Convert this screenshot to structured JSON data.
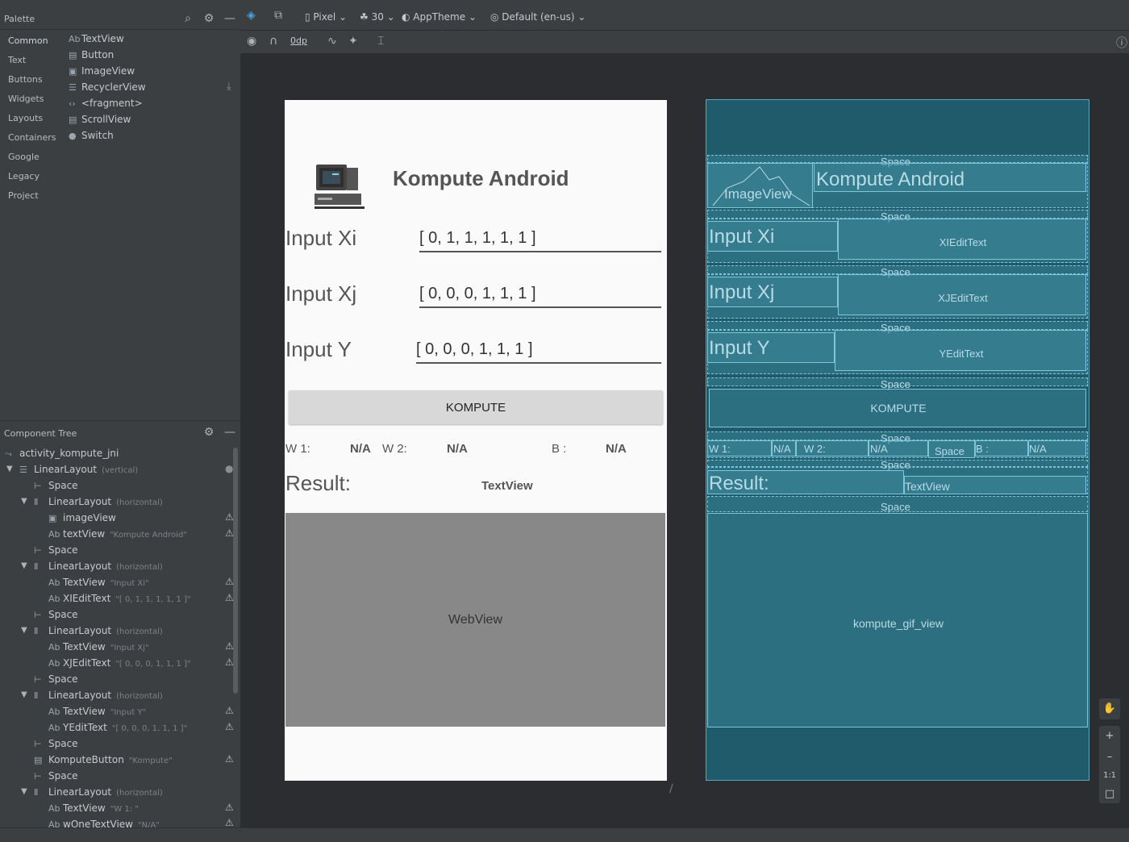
{
  "palette": {
    "title": "Palette",
    "categories": [
      "Common",
      "Text",
      "Buttons",
      "Widgets",
      "Layouts",
      "Containers",
      "Google",
      "Legacy",
      "Project"
    ],
    "items": [
      {
        "icon": "Ab",
        "label": "TextView"
      },
      {
        "icon": "▤",
        "label": "Button"
      },
      {
        "icon": "▣",
        "label": "ImageView"
      },
      {
        "icon": "☰",
        "label": "RecyclerView"
      },
      {
        "icon": "‹›",
        "label": "<fragment>"
      },
      {
        "icon": "▤",
        "label": "ScrollView"
      },
      {
        "icon": "●",
        "label": "Switch"
      }
    ]
  },
  "tree": {
    "title": "Component Tree",
    "root": "activity_kompute_jni",
    "rows": [
      {
        "icon": "☰",
        "label": "LinearLayout",
        "sub": "(vertical)",
        "expanded": true
      },
      {
        "icon": "⊢",
        "label": "Space",
        "sub": ""
      },
      {
        "icon": "Ⅱ",
        "label": "LinearLayout",
        "sub": "(horizontal)",
        "expanded": true
      },
      {
        "icon": "▣",
        "label": "imageView",
        "sub": ""
      },
      {
        "icon": "Ab",
        "label": "textView",
        "sub": "\"Kompute Android\""
      },
      {
        "icon": "⊢",
        "label": "Space",
        "sub": ""
      },
      {
        "icon": "Ⅱ",
        "label": "LinearLayout",
        "sub": "(horizontal)",
        "expanded": true
      },
      {
        "icon": "Ab",
        "label": "TextView",
        "sub": "\"Input Xi\""
      },
      {
        "icon": "Ab",
        "label": "XIEditText",
        "sub": "\"[ 0, 1, 1, 1, 1, 1 ]\""
      },
      {
        "icon": "⊢",
        "label": "Space",
        "sub": ""
      },
      {
        "icon": "Ⅱ",
        "label": "LinearLayout",
        "sub": "(horizontal)",
        "expanded": true
      },
      {
        "icon": "Ab",
        "label": "TextView",
        "sub": "\"Input Xj\""
      },
      {
        "icon": "Ab",
        "label": "XJEditText",
        "sub": "\"[ 0, 0, 0, 1, 1, 1 ]\""
      },
      {
        "icon": "⊢",
        "label": "Space",
        "sub": ""
      },
      {
        "icon": "Ⅱ",
        "label": "LinearLayout",
        "sub": "(horizontal)",
        "expanded": true
      },
      {
        "icon": "Ab",
        "label": "TextView",
        "sub": "\"Input Y\""
      },
      {
        "icon": "Ab",
        "label": "YEditText",
        "sub": "\"[ 0, 0, 0, 1, 1, 1 ]\""
      },
      {
        "icon": "⊢",
        "label": "Space",
        "sub": ""
      },
      {
        "icon": "▤",
        "label": "KomputeButton",
        "sub": "\"Kompute\""
      },
      {
        "icon": "⊢",
        "label": "Space",
        "sub": ""
      },
      {
        "icon": "Ⅱ",
        "label": "LinearLayout",
        "sub": "(horizontal)",
        "expanded": true
      },
      {
        "icon": "Ab",
        "label": "TextView",
        "sub": "\"W 1: \""
      },
      {
        "icon": "Ab",
        "label": "wOneTextView",
        "sub": "\"N/A\""
      }
    ]
  },
  "toolbar": {
    "device": "Pixel",
    "api": "30",
    "theme": "AppTheme",
    "locale": "Default (en-us)",
    "margin": "0dp"
  },
  "design": {
    "title": "Kompute Android",
    "input_xi_label": "Input Xi",
    "input_xi_value": "[ 0, 1, 1, 1, 1, 1 ]",
    "input_xj_label": "Input Xj",
    "input_xj_value": "[ 0, 0, 0, 1, 1, 1 ]",
    "input_y_label": "Input Y",
    "input_y_value": "[ 0, 0, 0, 1, 1, 1 ]",
    "button": "KOMPUTE",
    "w1_label": "W 1:",
    "w1_value": "N/A",
    "w2_label": "W 2:",
    "w2_value": "N/A",
    "b_label": "B :",
    "b_value": "N/A",
    "result_label": "Result:",
    "result_value": "TextView",
    "webview": "WebView"
  },
  "blueprint": {
    "space": "Space",
    "image_view": "ImageView",
    "title": "Kompute Android",
    "input_xi": "Input Xi",
    "xi_edit": "XIEditText",
    "input_xj": "Input Xj",
    "xj_edit": "XJEditText",
    "input_y": "Input Y",
    "y_edit": "YEditText",
    "button": "KOMPUTE",
    "w1": "W 1:",
    "na1": "N/A",
    "w2": "W 2:",
    "na2": "N/A",
    "space_inline": "Space",
    "b": "B :",
    "na3": "N/A",
    "result": "Result:",
    "textview": "TextView",
    "gif_view": "kompute_gif_view"
  },
  "zoom": {
    "fit": "1:1"
  }
}
